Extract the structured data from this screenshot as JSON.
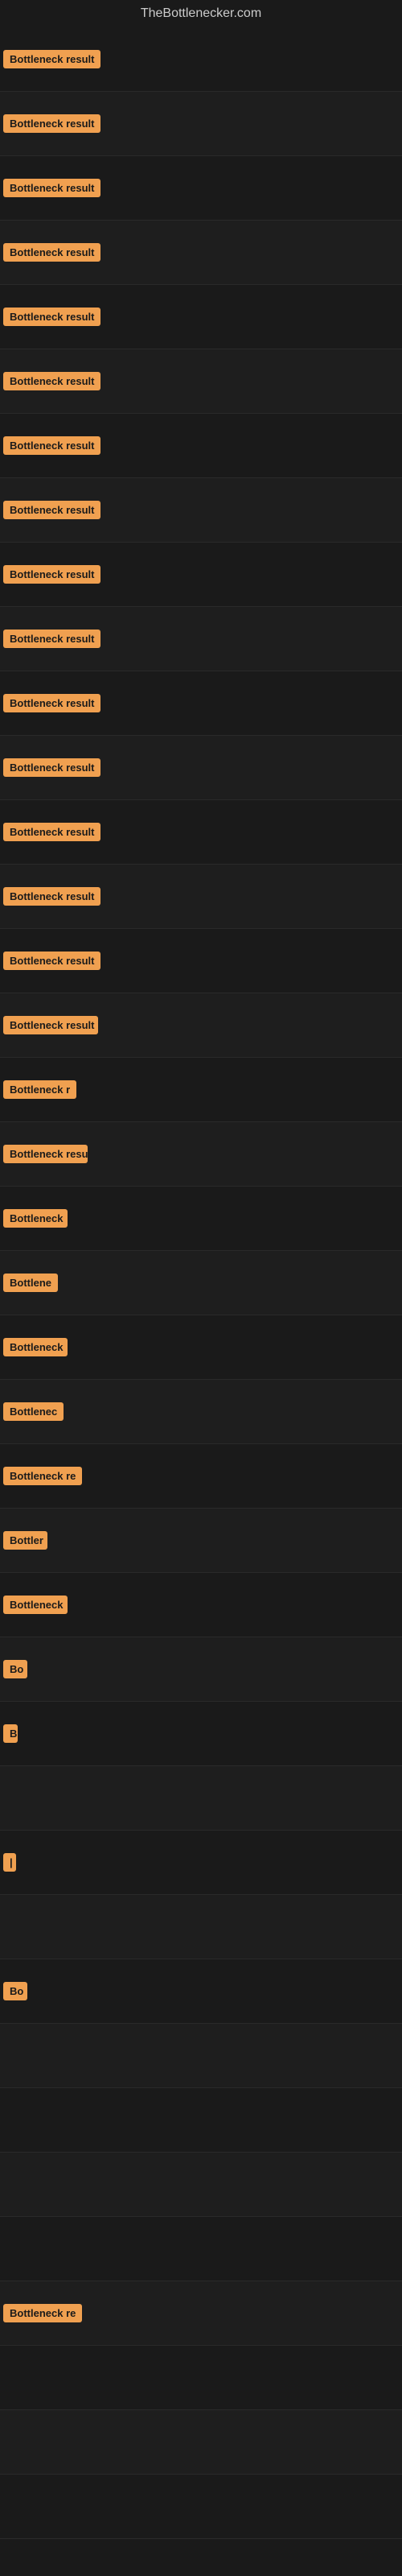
{
  "site": {
    "title": "TheBottlenecker.com"
  },
  "results": [
    {
      "id": 1,
      "label": "Bottleneck result",
      "truncated": false
    },
    {
      "id": 2,
      "label": "Bottleneck result",
      "truncated": false
    },
    {
      "id": 3,
      "label": "Bottleneck result",
      "truncated": false
    },
    {
      "id": 4,
      "label": "Bottleneck result",
      "truncated": false
    },
    {
      "id": 5,
      "label": "Bottleneck result",
      "truncated": false
    },
    {
      "id": 6,
      "label": "Bottleneck result",
      "truncated": false
    },
    {
      "id": 7,
      "label": "Bottleneck result",
      "truncated": false
    },
    {
      "id": 8,
      "label": "Bottleneck result",
      "truncated": false
    },
    {
      "id": 9,
      "label": "Bottleneck result",
      "truncated": false
    },
    {
      "id": 10,
      "label": "Bottleneck result",
      "truncated": false
    },
    {
      "id": 11,
      "label": "Bottleneck result",
      "truncated": false
    },
    {
      "id": 12,
      "label": "Bottleneck result",
      "truncated": false
    },
    {
      "id": 13,
      "label": "Bottleneck result",
      "truncated": false
    },
    {
      "id": 14,
      "label": "Bottleneck result",
      "truncated": false
    },
    {
      "id": 15,
      "label": "Bottleneck result",
      "truncated": false
    },
    {
      "id": 16,
      "label": "Bottleneck result",
      "truncated": true,
      "display": "Bottleneck result"
    },
    {
      "id": 17,
      "label": "Bottleneck r",
      "truncated": true,
      "display": "Bottleneck r"
    },
    {
      "id": 18,
      "label": "Bottleneck resu",
      "truncated": true,
      "display": "Bottleneck resu"
    },
    {
      "id": 19,
      "label": "Bottleneck",
      "truncated": true,
      "display": "Bottleneck"
    },
    {
      "id": 20,
      "label": "Bottlene",
      "truncated": true,
      "display": "Bottlene"
    },
    {
      "id": 21,
      "label": "Bottleneck",
      "truncated": true,
      "display": "Bottleneck"
    },
    {
      "id": 22,
      "label": "Bottlenec",
      "truncated": true,
      "display": "Bottlenec"
    },
    {
      "id": 23,
      "label": "Bottleneck re",
      "truncated": true,
      "display": "Bottleneck re"
    },
    {
      "id": 24,
      "label": "Bottler",
      "truncated": true,
      "display": "Bottler"
    },
    {
      "id": 25,
      "label": "Bottleneck",
      "truncated": true,
      "display": "Bottleneck"
    },
    {
      "id": 26,
      "label": "Bo",
      "truncated": true,
      "display": "Bo"
    },
    {
      "id": 27,
      "label": "B",
      "truncated": true,
      "display": "B"
    },
    {
      "id": 28,
      "label": "",
      "truncated": true,
      "display": ""
    },
    {
      "id": 29,
      "label": "|",
      "truncated": true,
      "display": "|"
    },
    {
      "id": 30,
      "label": "",
      "truncated": true,
      "display": ""
    },
    {
      "id": 31,
      "label": "Bo",
      "truncated": true,
      "display": "Bo"
    },
    {
      "id": 32,
      "label": "",
      "truncated": true,
      "display": ""
    },
    {
      "id": 33,
      "label": "",
      "truncated": true,
      "display": ""
    },
    {
      "id": 34,
      "label": "",
      "truncated": true,
      "display": ""
    },
    {
      "id": 35,
      "label": "",
      "truncated": true,
      "display": ""
    },
    {
      "id": 36,
      "label": "Bottleneck re",
      "truncated": true,
      "display": "Bottleneck re"
    },
    {
      "id": 37,
      "label": "",
      "truncated": true,
      "display": ""
    },
    {
      "id": 38,
      "label": "",
      "truncated": true,
      "display": ""
    },
    {
      "id": 39,
      "label": "",
      "truncated": true,
      "display": ""
    }
  ],
  "badge_colors": {
    "background": "#f0a050",
    "text": "#1a1a1a"
  }
}
